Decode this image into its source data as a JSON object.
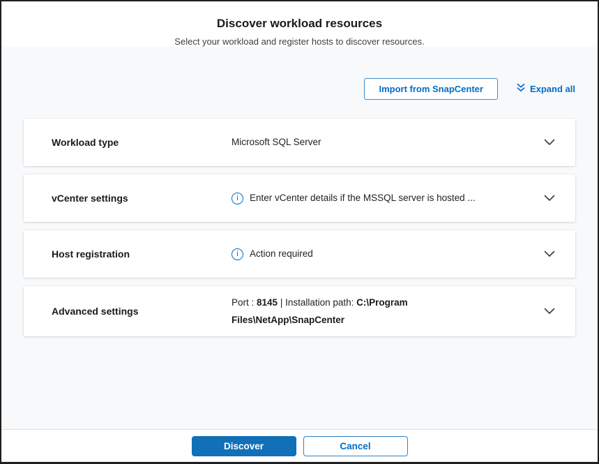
{
  "page": {
    "title": "Discover workload resources",
    "subtitle": "Select your workload and register hosts to discover resources."
  },
  "toolbar": {
    "import_label": "Import from SnapCenter",
    "expand_label": "Expand all"
  },
  "accordions": [
    {
      "label": "Workload type",
      "summary": "Microsoft SQL Server",
      "has_info": false
    },
    {
      "label": "vCenter settings",
      "summary": "Enter vCenter details if the MSSQL server is hosted ...",
      "has_info": true
    },
    {
      "label": "Host registration",
      "summary": "Action required",
      "has_info": true
    },
    {
      "label": "Advanced settings",
      "parts": {
        "port_label": "Port : ",
        "port_value": "8145",
        "path_label": " | Installation path: ",
        "path_value": "C:\\Program Files\\NetApp\\SnapCenter"
      }
    }
  ],
  "footer": {
    "discover_label": "Discover",
    "cancel_label": "Cancel"
  },
  "icons": {
    "info_glyph": "i"
  },
  "colors": {
    "accent": "#006dc9",
    "primary_button": "#1170b8",
    "page_background": "#f8f9fb"
  }
}
